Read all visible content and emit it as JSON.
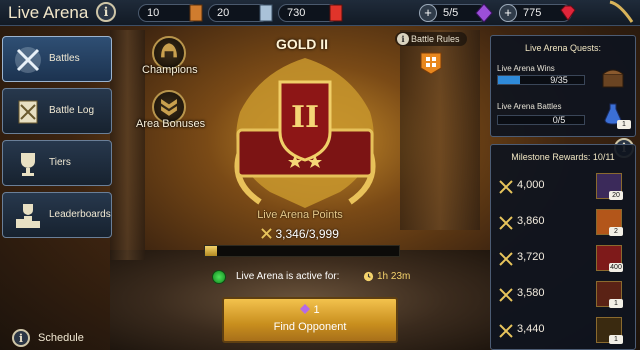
{
  "header": {
    "title": "Live Arena",
    "resources": [
      {
        "name": "silver-key",
        "value": "10"
      },
      {
        "name": "silver-key",
        "value": "20"
      },
      {
        "name": "gold-key",
        "value": "730"
      },
      {
        "name": "arena-token",
        "value": "5/5"
      },
      {
        "name": "gem",
        "value": "775"
      }
    ]
  },
  "menu": {
    "items": [
      {
        "label": "Battles",
        "icon": "crossed-swords-icon",
        "active": true
      },
      {
        "label": "Battle Log",
        "icon": "scroll-swords-icon",
        "active": false
      },
      {
        "label": "Tiers",
        "icon": "trophy-icon",
        "active": false
      },
      {
        "label": "Leaderboards",
        "icon": "podium-trophy-icon",
        "active": false
      }
    ]
  },
  "champions_label": "Champions",
  "area_bonuses_label": "Area Bonuses",
  "rank": {
    "title": "GOLD II",
    "roman": "II",
    "stars": 2
  },
  "battle_rules_label": "Battle Rules",
  "points": {
    "label": "Live Arena Points",
    "value": "3,346/3,999",
    "progress": 0.06
  },
  "active_status": {
    "label": "Live Arena is active for:",
    "timer": "1h 23m"
  },
  "find_opponent": {
    "cost": "1",
    "label": "Find Opponent"
  },
  "schedule_label": "Schedule",
  "quests": {
    "title": "Live Arena Quests:",
    "items": [
      {
        "label": "Live Arena Wins",
        "progress_text": "9/35",
        "progress": 0.26,
        "reward": ""
      },
      {
        "label": "Live Arena Battles",
        "progress_text": "0/5",
        "progress": 0.0,
        "reward": "1"
      }
    ]
  },
  "milestones": {
    "title": "Milestone Rewards: 10/11",
    "items": [
      {
        "points": "4,000",
        "reward_count": "20",
        "color": "#3b2a5a"
      },
      {
        "points": "3,860",
        "reward_count": "2",
        "color": "#b3561a"
      },
      {
        "points": "3,720",
        "reward_count": "400",
        "color": "#7e1a1a"
      },
      {
        "points": "3,580",
        "reward_count": "1",
        "color": "#5a2215"
      },
      {
        "points": "3,440",
        "reward_count": "1",
        "color": "#3a2a10"
      }
    ]
  },
  "colors": {
    "accent_gold": "#f2c94c",
    "quest_bar": "#2f8ad9",
    "active_green": "#3ed552"
  }
}
